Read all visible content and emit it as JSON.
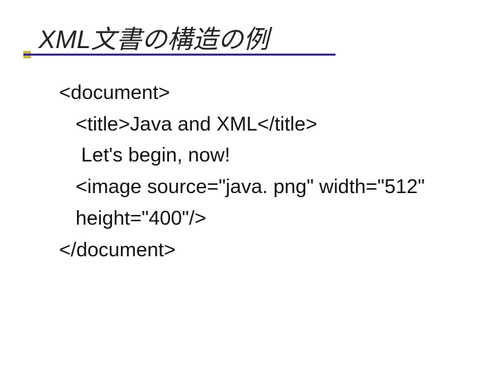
{
  "slide": {
    "title": "XML文書の構造の例",
    "code": {
      "line1": "<document>",
      "line2": "<title>Java and XML</title>",
      "line3": " Let's begin, now!",
      "line4": "<image source=\"java. png\" width=\"512\"",
      "line5": "height=\"400\"/>",
      "line6": "</document>"
    }
  }
}
